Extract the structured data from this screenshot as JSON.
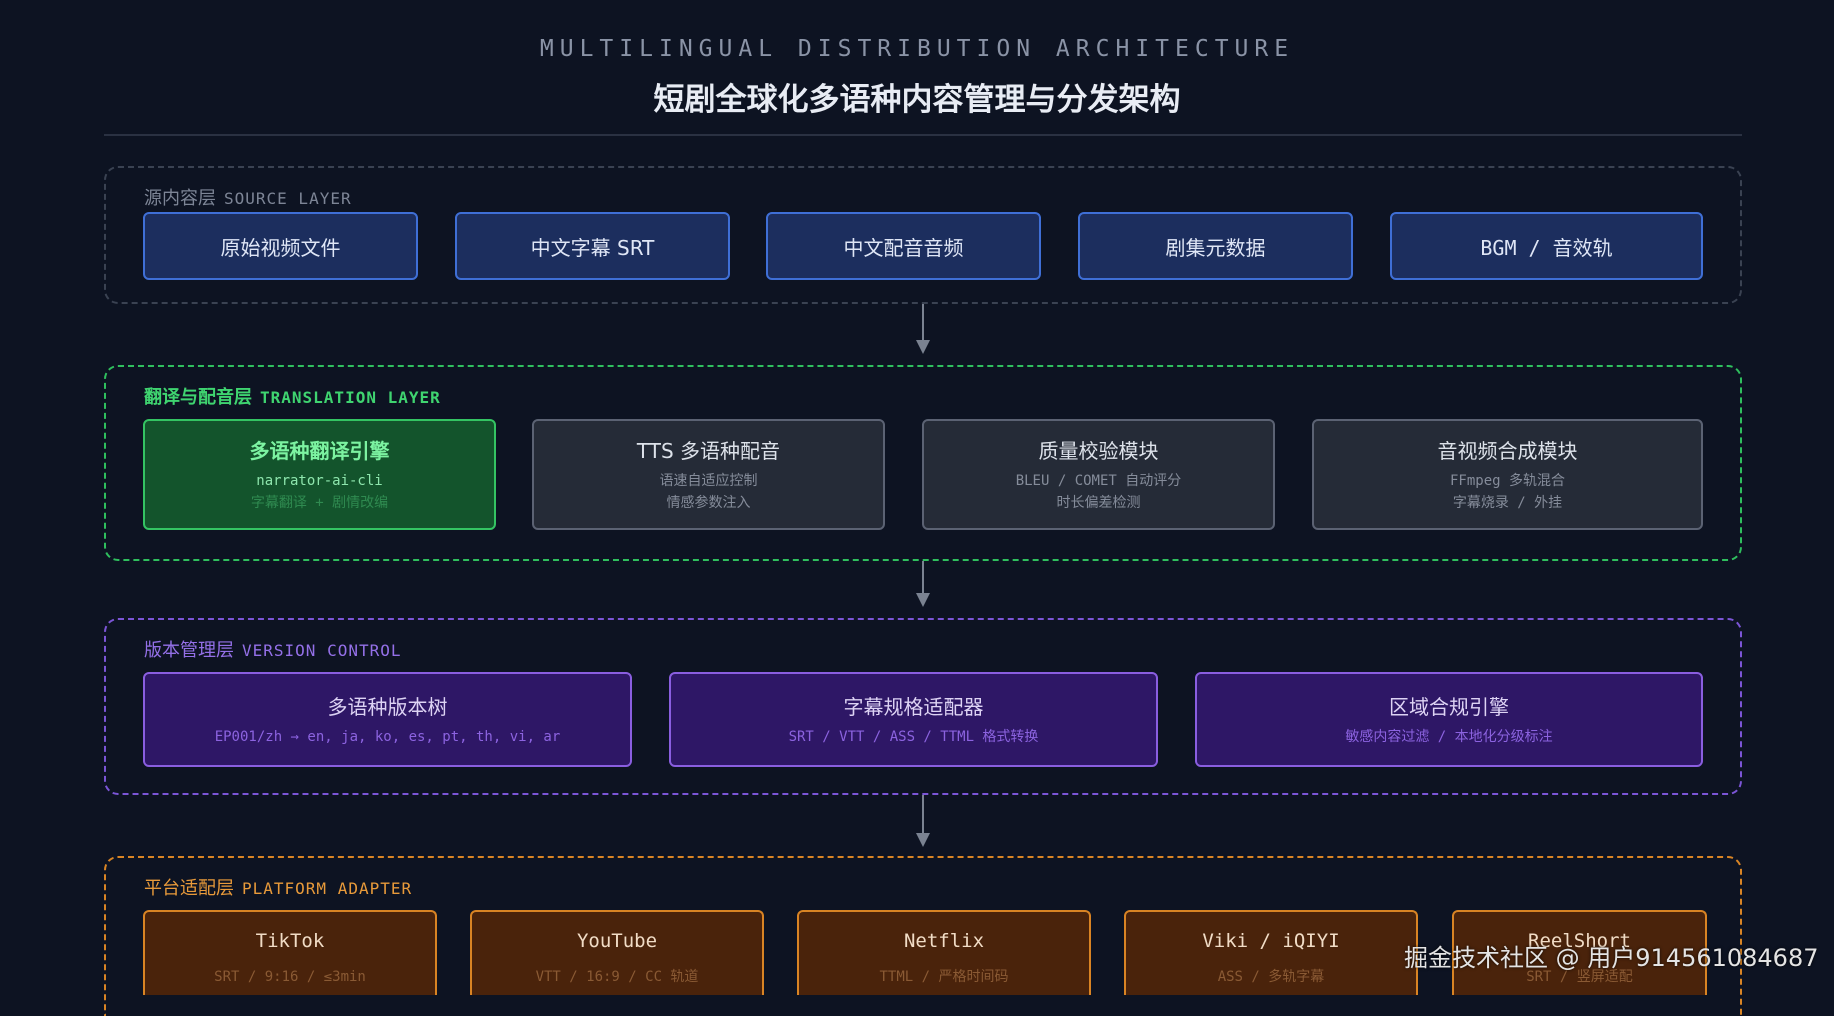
{
  "header": {
    "subtitle": "MULTILINGUAL DISTRIBUTION ARCHITECTURE",
    "title": "短剧全球化多语种内容管理与分发架构"
  },
  "source_layer": {
    "label_cn": "源内容层",
    "label_en": "SOURCE LAYER",
    "color": "#3f6fd6",
    "boxes": [
      "原始视频文件",
      "中文字幕 SRT",
      "中文配音音频",
      "剧集元数据",
      "BGM / 音效轨"
    ]
  },
  "translation_layer": {
    "label_cn": "翻译与配音层",
    "label_en": "TRANSLATION LAYER",
    "color": "#34c463",
    "boxes": [
      {
        "title": "多语种翻译引擎",
        "line1": "narrator-ai-cli",
        "line2": "字幕翻译 + 剧情改编"
      },
      {
        "title": "TTS 多语种配音",
        "line1": "语速自适应控制",
        "line2": "情感参数注入"
      },
      {
        "title": "质量校验模块",
        "line1": "BLEU / COMET 自动评分",
        "line2": "时长偏差检测"
      },
      {
        "title": "音视频合成模块",
        "line1": "FFmpeg 多轨混合",
        "line2": "字幕烧录 / 外挂"
      }
    ]
  },
  "version_layer": {
    "label_cn": "版本管理层",
    "label_en": "VERSION CONTROL",
    "color": "#8a5ee0",
    "boxes": [
      {
        "title": "多语种版本树",
        "line1": "EP001/zh → en, ja, ko, es, pt, th, vi, ar"
      },
      {
        "title": "字幕规格适配器",
        "line1": "SRT / VTT / ASS / TTML 格式转换"
      },
      {
        "title": "区域合规引擎",
        "line1": "敏感内容过滤 / 本地化分级标注"
      }
    ]
  },
  "platform_layer": {
    "label_cn": "平台适配层",
    "label_en": "PLATFORM ADAPTER",
    "color": "#d98424",
    "boxes": [
      {
        "title": "TikTok",
        "line1": "SRT / 9:16 / ≤3min"
      },
      {
        "title": "YouTube",
        "line1": "VTT / 16:9 / CC 轨道"
      },
      {
        "title": "Netflix",
        "line1": "TTML / 严格时间码"
      },
      {
        "title": "Viki / iQIYI",
        "line1": "ASS / 多轨字幕"
      },
      {
        "title": "ReelShort",
        "line1": "SRT / 竖屏适配"
      }
    ]
  },
  "watermark": "掘金技术社区 @ 用户914561084687"
}
